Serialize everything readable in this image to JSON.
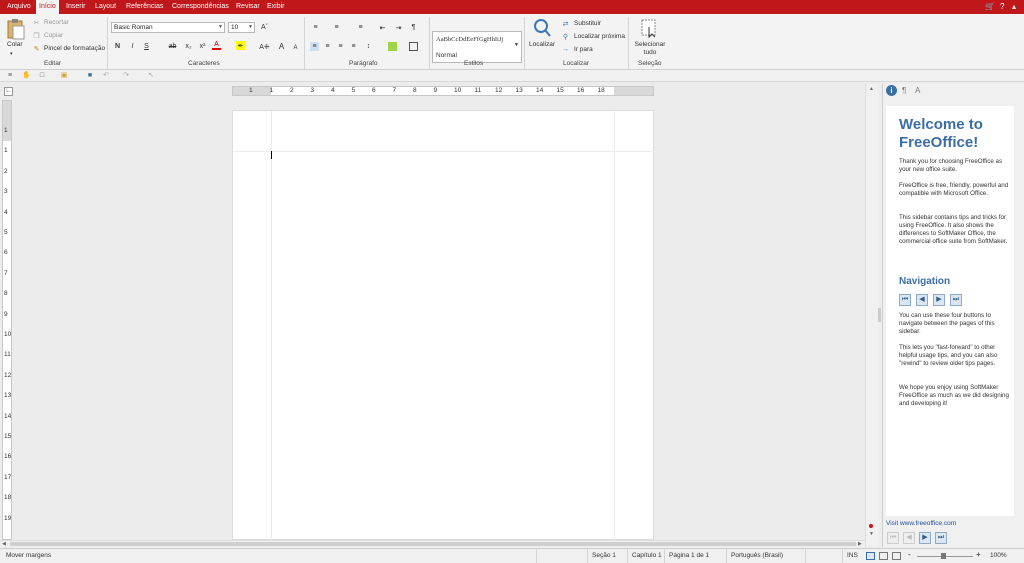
{
  "menubar": {
    "items": [
      "Arquivo",
      "Início",
      "Inserir",
      "Layout",
      "Referências",
      "Correspondências",
      "Revisar",
      "Exibir"
    ],
    "active_index": 1,
    "right_icons": [
      "cart-icon",
      "help-icon",
      "ribbon-toggle-icon"
    ],
    "help_label": "?",
    "accent_color": "#c0171b"
  },
  "ribbon": {
    "editar": {
      "colar": "Colar",
      "recortar": "Recortar",
      "copiar": "Copiar",
      "pincel": "Pincel de formatação",
      "label": "Editar"
    },
    "caracteres": {
      "font_name": "Basic Roman",
      "font_size": "10",
      "bold": "N",
      "italic": "I",
      "strike": "S",
      "label": "Caracteres"
    },
    "paragrafo": {
      "label": "Parágrafo"
    },
    "estilos": {
      "preview": "AaBbCcDdEeFfGgHhIiJj",
      "style_name": "Normal",
      "label": "Estilos"
    },
    "localizar": {
      "localizar": "Localizar",
      "substituir": "Substituir",
      "localizar_proxima": "Localizar próxima",
      "ir_para": "Ir para",
      "label": "Localizar"
    },
    "selecao": {
      "selecionar_tudo": "Selecionar tudo",
      "label": "Seleção"
    }
  },
  "hruler": {
    "numbers": [
      "1",
      "1",
      "2",
      "3",
      "4",
      "5",
      "6",
      "7",
      "8",
      "9",
      "10",
      "11",
      "12",
      "13",
      "14",
      "15",
      "16",
      "18"
    ]
  },
  "vruler": {
    "numbers": [
      "1",
      "1",
      "2",
      "3",
      "4",
      "5",
      "6",
      "7",
      "8",
      "9",
      "10",
      "11",
      "12",
      "13",
      "14",
      "15",
      "16",
      "17",
      "18",
      "19"
    ]
  },
  "sidebar": {
    "title": "Welcome to FreeOffice!",
    "p1": "Thank you for choosing FreeOffice as your new office suite.",
    "p2": "FreeOffice is free, friendly, powerful and compatible with Microsoft Office.",
    "p3": "This sidebar contains tips and tricks for using FreeOffice. It also shows the differences to SoftMaker Office, the commercial office suite from SoftMaker.",
    "nav_heading": "Navigation",
    "p4": "You can use these four buttons to navigate between the pages of this sidebar.",
    "p5": "This lets you \"fast-forward\" to other helpful usage tips, and you can also \"rewind\" to review older tips pages.",
    "p6": "We hope you enjoy using SoftMaker FreeOffice as much as we did designing and developing it!",
    "link": "Visit www.freeoffice.com"
  },
  "statusbar": {
    "hint": "Mover margens",
    "secao": "Seção 1",
    "capitulo": "Capítulo 1",
    "pagina": "Página 1 de 1",
    "idioma": "Português (Brasil)",
    "ins": "INS",
    "zoom": "100%"
  }
}
